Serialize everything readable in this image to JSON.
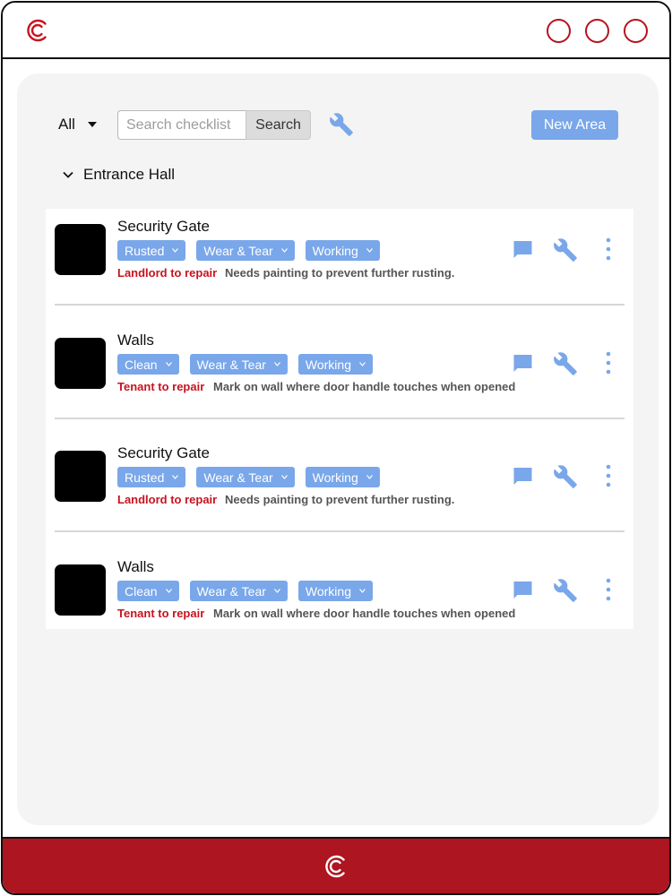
{
  "colors": {
    "brand_red": "#ad1520",
    "accent_blue": "#79a7ea",
    "repair_red": "#c8131f",
    "note_gray": "#555555"
  },
  "header": {
    "logo_icon": "brand-c-logo",
    "window_buttons": [
      "circle-button",
      "circle-button",
      "circle-button"
    ]
  },
  "toolbar": {
    "filter_value": "All",
    "search_placeholder": "Search checklist",
    "search_label": "Search",
    "tools_icon": "wrench-icon",
    "new_area_label": "New Area"
  },
  "section": {
    "title": "Entrance Hall",
    "expanded": true
  },
  "items": [
    {
      "title": "Security Gate",
      "chips": [
        "Rusted",
        "Wear & Tear",
        "Working"
      ],
      "repair": "Landlord to repair",
      "note": "Needs painting to prevent further rusting."
    },
    {
      "title": "Walls",
      "chips": [
        "Clean",
        "Wear & Tear",
        "Working"
      ],
      "repair": "Tenant to repair",
      "note": "Mark on wall where door handle touches when opened"
    },
    {
      "title": "Security Gate",
      "chips": [
        "Rusted",
        "Wear & Tear",
        "Working"
      ],
      "repair": "Landlord to repair",
      "note": "Needs painting to prevent further rusting."
    },
    {
      "title": "Walls",
      "chips": [
        "Clean",
        "Wear & Tear",
        "Working"
      ],
      "repair": "Tenant to repair",
      "note": "Mark on wall where door handle touches when opened"
    }
  ]
}
